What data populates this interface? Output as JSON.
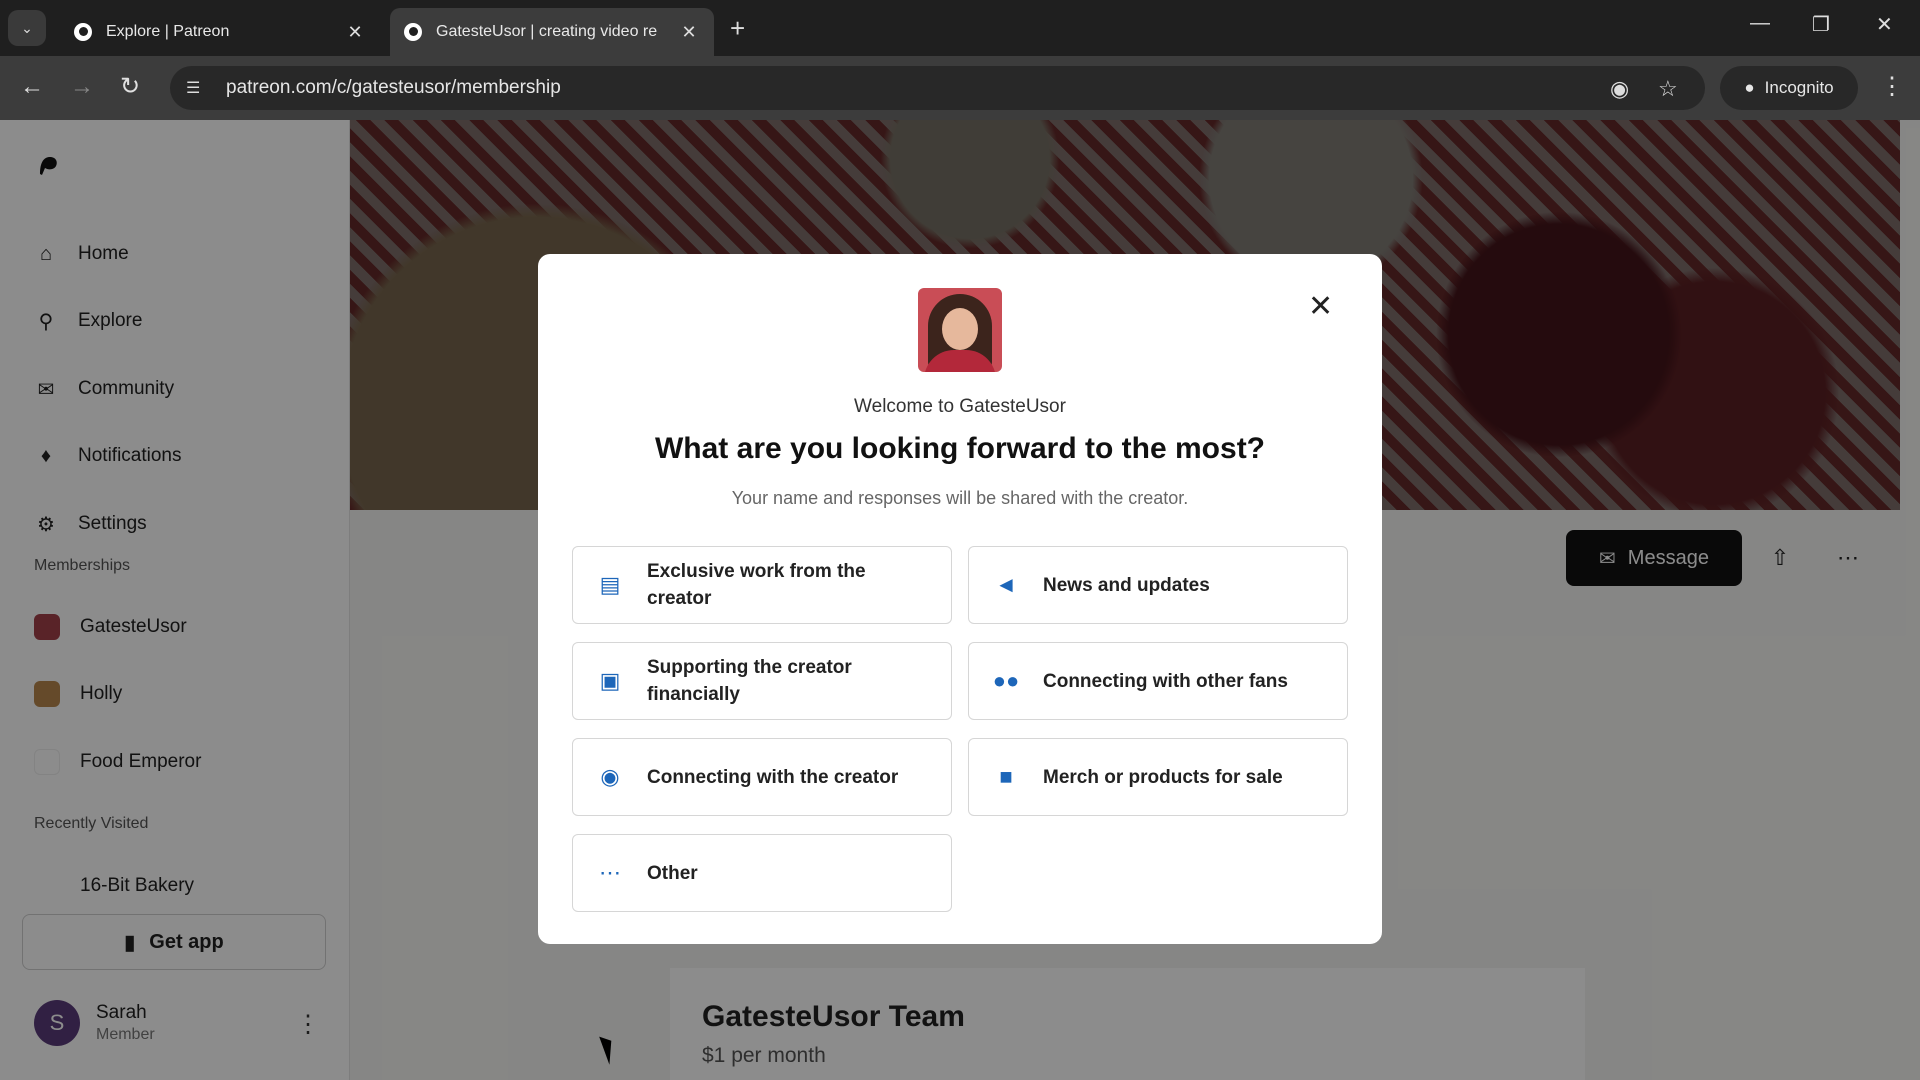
{
  "browser": {
    "tabs": [
      {
        "title": "Explore | Patreon"
      },
      {
        "title": "GatesteUsor | creating video re"
      }
    ],
    "url": "patreon.com/c/gatesteusor/membership",
    "incognito_label": "Incognito"
  },
  "sidebar": {
    "nav": [
      {
        "label": "Home",
        "icon": "home-icon"
      },
      {
        "label": "Explore",
        "icon": "search-icon"
      },
      {
        "label": "Community",
        "icon": "chat-icon"
      },
      {
        "label": "Notifications",
        "icon": "bell-icon"
      },
      {
        "label": "Settings",
        "icon": "gear-icon"
      }
    ],
    "memberships_label": "Memberships",
    "memberships": [
      {
        "label": "GatesteUsor"
      },
      {
        "label": "Holly"
      },
      {
        "label": "Food Emperor"
      }
    ],
    "recently_visited_label": "Recently Visited",
    "recent": [
      {
        "label": "16-Bit Bakery"
      }
    ],
    "get_app_label": "Get app",
    "user": {
      "initial": "S",
      "name": "Sarah",
      "role": "Member"
    }
  },
  "profile": {
    "message_label": "Message",
    "team_title": "GatesteUsor Team",
    "team_price": "$1 per month"
  },
  "modal": {
    "welcome": "Welcome to GatesteUsor",
    "question": "What are you looking forward to the most?",
    "note": "Your name and responses will be shared with the creator.",
    "options": [
      {
        "label": "Exclusive work from the creator",
        "icon": "document-icon"
      },
      {
        "label": "News and updates",
        "icon": "megaphone-icon"
      },
      {
        "label": "Supporting the creator financially",
        "icon": "gift-icon"
      },
      {
        "label": "Connecting with other fans",
        "icon": "people-icon"
      },
      {
        "label": "Connecting with the creator",
        "icon": "chat-icon"
      },
      {
        "label": "Merch or products for sale",
        "icon": "bag-icon"
      },
      {
        "label": "Other",
        "icon": "more-icon"
      }
    ]
  },
  "colors": {
    "accent": "#1d66b9",
    "overlay": "#000000"
  }
}
